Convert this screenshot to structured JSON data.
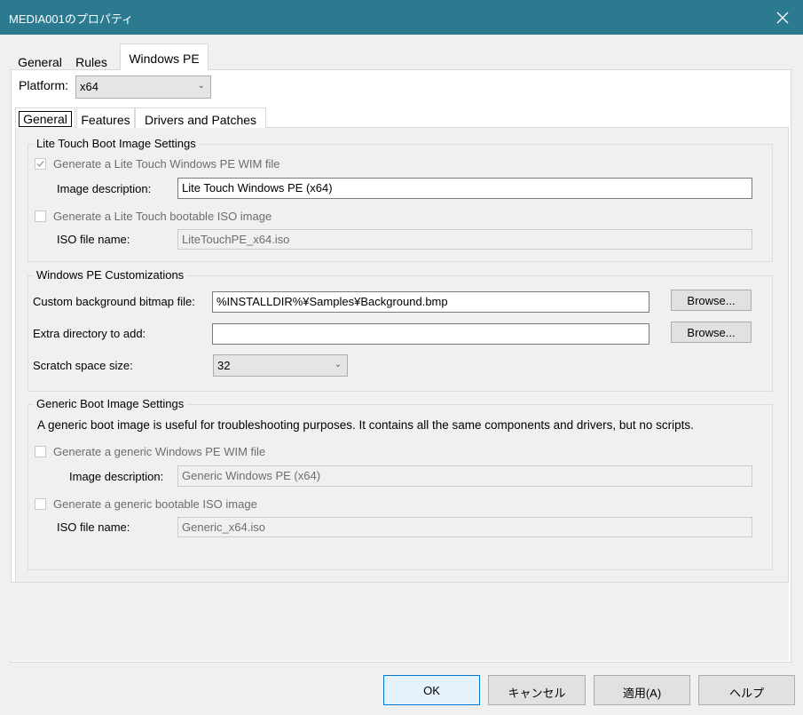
{
  "window": {
    "title": "MEDIA001のプロパティ"
  },
  "outer_tabs": [
    "General",
    "Rules",
    "Windows PE"
  ],
  "platform": {
    "label": "Platform:",
    "value": "x64"
  },
  "inner_tabs": [
    "General",
    "Features",
    "Drivers and Patches"
  ],
  "lite_touch": {
    "title": "Lite Touch Boot Image Settings",
    "wim_checkbox": "Generate a Lite Touch Windows PE WIM file",
    "image_desc_label": "Image description:",
    "image_desc_value": "Lite Touch Windows PE (x64)",
    "iso_checkbox": "Generate a Lite Touch bootable ISO image",
    "iso_label": "ISO file name:",
    "iso_value": "LiteTouchPE_x64.iso"
  },
  "customizations": {
    "title": "Windows PE Customizations",
    "bitmap_label": "Custom background bitmap file:",
    "bitmap_value": "%INSTALLDIR%¥Samples¥Background.bmp",
    "browse": "Browse...",
    "extra_label": "Extra directory to add:",
    "extra_value": "",
    "scratch_label": "Scratch space size:",
    "scratch_value": "32"
  },
  "generic": {
    "title": "Generic Boot Image Settings",
    "description": "A generic boot image is useful for troubleshooting purposes.  It contains all the same components and drivers, but no scripts.",
    "wim_checkbox": "Generate a generic Windows PE WIM file",
    "image_desc_label": "Image description:",
    "image_desc_value": "Generic Windows PE (x64)",
    "iso_checkbox": "Generate a generic bootable ISO image",
    "iso_label": "ISO file name:",
    "iso_value": "Generic_x64.iso"
  },
  "buttons": {
    "ok": "OK",
    "cancel": "キャンセル",
    "apply": "適用(A)",
    "help": "ヘルプ"
  },
  "colors": {
    "titlebar": "#2b7a8f",
    "accent": "#0078d7"
  }
}
